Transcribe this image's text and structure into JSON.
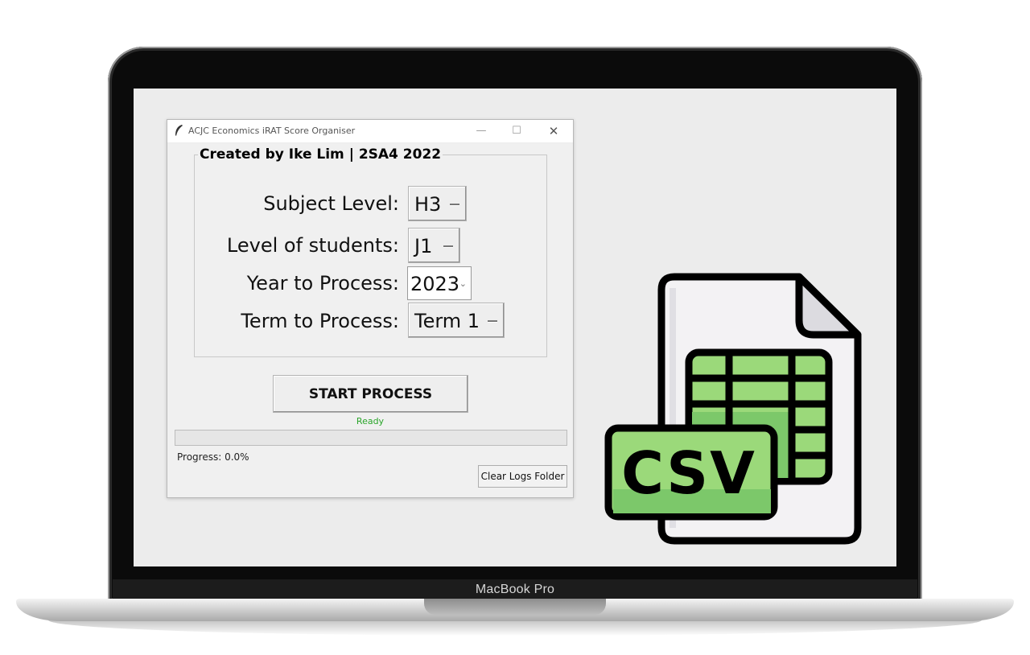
{
  "device": {
    "brand_label": "MacBook Pro"
  },
  "window": {
    "title": "ACJC Economics iRAT Score Organiser",
    "controls": {
      "minimize": "—",
      "maximize": "☐",
      "close": "✕"
    }
  },
  "form": {
    "group_title": "Created by Ike Lim | 2SA4 2022",
    "subject_level": {
      "label": "Subject Level:",
      "value": "H3"
    },
    "student_level": {
      "label": "Level of students:",
      "value": "J1"
    },
    "year": {
      "label": "Year to Process:",
      "value": "2023"
    },
    "term": {
      "label": "Term to Process:",
      "value": "Term 1"
    }
  },
  "actions": {
    "start_label": "START PROCESS",
    "status_text": "Ready",
    "progress_label": "Progress: 0.0%",
    "progress_value": 0.0,
    "clear_logs_label": "Clear Logs Folder"
  },
  "csv_graphic": {
    "text": "CSV",
    "icon": "csv-file-icon",
    "colors": {
      "green": "#9bd97a",
      "dark_green": "#7cc86a",
      "paper": "#f3f2f4",
      "fold": "#dcdbe0"
    }
  },
  "colors": {
    "status_green": "#2aa52a",
    "progress_fill": "#06b025"
  }
}
